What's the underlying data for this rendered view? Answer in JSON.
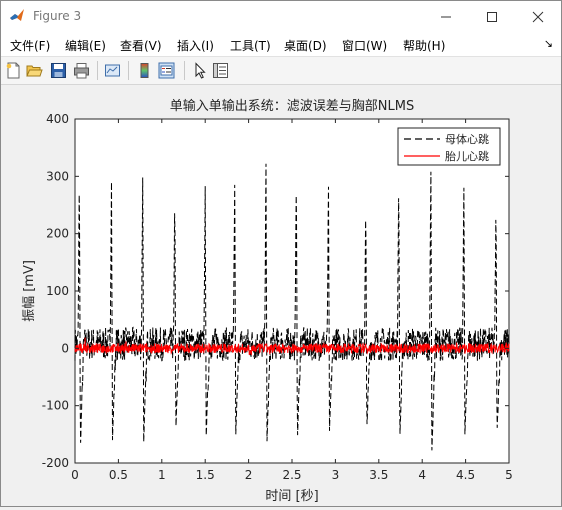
{
  "window": {
    "title": "Figure 3"
  },
  "menu": [
    "文件(F)",
    "编辑(E)",
    "查看(V)",
    "插入(I)",
    "工具(T)",
    "桌面(D)",
    "窗口(W)",
    "帮助(H)"
  ],
  "toolbar": {
    "icons": [
      "new-figure-icon",
      "open-file-icon",
      "save-icon",
      "print-icon",
      "link-plot-icon",
      "colorbar-icon",
      "legend-icon",
      "edit-plot-arrow-icon",
      "property-inspector-icon"
    ]
  },
  "chart_data": {
    "type": "line",
    "title": "单输入单输出系统：滤波误差与胸部NLMS",
    "xlabel": "时间 [秒]",
    "ylabel": "振幅 [mV]",
    "xlim": [
      0,
      5
    ],
    "ylim": [
      -200,
      400
    ],
    "xticks": [
      "0",
      "0.5",
      "1",
      "1.5",
      "2",
      "2.5",
      "3",
      "3.5",
      "4",
      "4.5",
      "5"
    ],
    "yticks": [
      "-200",
      "-100",
      "0",
      "100",
      "200",
      "300",
      "400"
    ],
    "grid": false,
    "legend_position": "top-right",
    "series": [
      {
        "name": "母体心跳",
        "style": "dashed",
        "color": "#000000",
        "beat_times": [
          0.05,
          0.42,
          0.78,
          1.15,
          1.5,
          1.84,
          2.2,
          2.55,
          2.92,
          3.35,
          3.73,
          4.1,
          4.48,
          4.85
        ],
        "beat_peaks": [
          305,
          290,
          298,
          268,
          283,
          285,
          322,
          310,
          282,
          255,
          300,
          308,
          280,
          255
        ],
        "beat_troughs": [
          -175,
          -160,
          -163,
          -142,
          -152,
          -150,
          -162,
          -160,
          -144,
          -140,
          -157,
          -178,
          -150,
          -148
        ],
        "noise_band": [
          -25,
          40
        ]
      },
      {
        "name": "胎儿心跳",
        "style": "solid",
        "color": "#ff0000",
        "baseline": 0,
        "noise_band": [
          -15,
          15
        ]
      }
    ]
  }
}
